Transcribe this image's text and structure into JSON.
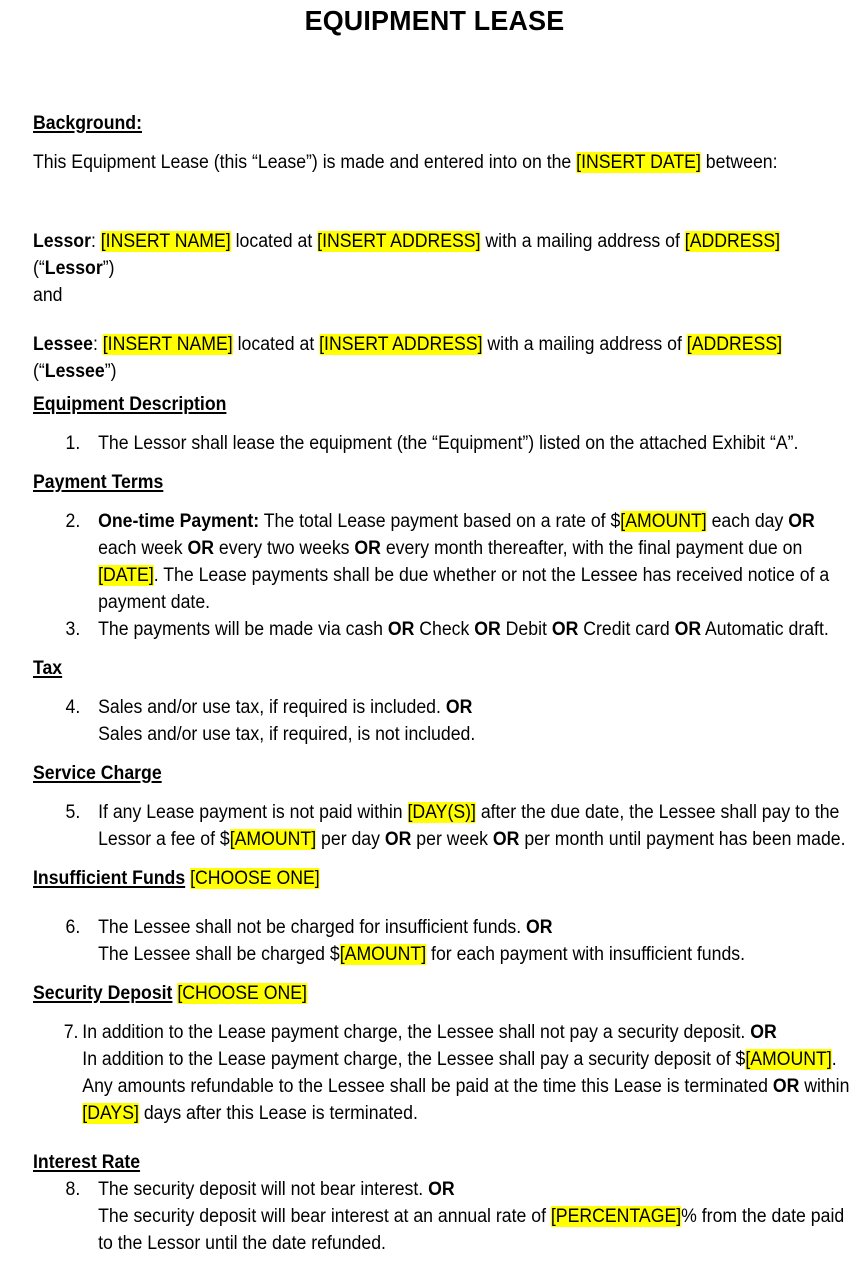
{
  "document": {
    "title": "EQUIPMENT LEASE",
    "sections": {
      "background": {
        "heading": "Background:",
        "intro_1": "This Equipment Lease (this “Lease”) is made and entered into on the ",
        "intro_date": "[INSERT DATE]",
        "intro_2": " between:"
      },
      "parties": {
        "lessor": {
          "label": "Lessor",
          "colon": ": ",
          "name": "[INSERT NAME]",
          "located_at": " located at ",
          "address": "[INSERT ADDRESS]",
          "mailing": " with a mailing address of ",
          "mailing_address": "[ADDRESS]",
          "quote_open": " (“",
          "term": "Lessor",
          "quote_close": "”)"
        },
        "conjunction": "and",
        "lessee": {
          "label": "Lessee",
          "colon": ": ",
          "name": "[INSERT NAME]",
          "located_at": " located at ",
          "address": "[INSERT ADDRESS]",
          "mailing": " with a mailing address of ",
          "mailing_address": "[ADDRESS]",
          "quote_open": " (“",
          "term": "Lessee",
          "quote_close": "”)"
        }
      },
      "equipment_description": {
        "heading": "Equipment Description",
        "item_number": "1.",
        "item_text": "The Lessor shall lease the equipment (the “Equipment”) listed on the attached Exhibit “A”."
      },
      "payment_terms": {
        "heading": "Payment Terms",
        "item2": {
          "number": "2.",
          "lead_bold": "One-time Payment:",
          "t1": " The total Lease payment based on a rate of $",
          "amount": "[AMOUNT]",
          "t2": " each day ",
          "or1": "OR",
          "t3": " each week ",
          "or2": "OR",
          "t4": " every two weeks ",
          "or3": "OR",
          "t5": " every month thereafter, with the final payment due on ",
          "date": "[DATE]",
          "t6": ". The Lease payments shall be due whether or not the Lessee has received notice of a payment date."
        },
        "item3": {
          "number": "3.",
          "t1": "The payments will be made via cash ",
          "or1": "OR",
          "t2": " Check ",
          "or2": "OR",
          "t3": " Debit ",
          "or3": "OR",
          "t4": " Credit card ",
          "or4": "OR",
          "t5": " Automatic draft."
        }
      },
      "tax": {
        "heading": "Tax",
        "item4": {
          "number": "4.",
          "option_a": "Sales and/or use tax, if required is included. ",
          "or": "OR",
          "option_b": "Sales and/or use tax, if required, is not included."
        }
      },
      "service_charge": {
        "heading": "Service Charge",
        "item5": {
          "number": "5.",
          "t1": "If any Lease payment is not paid within ",
          "days": "[DAY(S)]",
          "t2": " after the due date, the Lessee shall pay to the Lessor a fee of $",
          "amount": "[AMOUNT]",
          "t3": " per day ",
          "or1": "OR",
          "t4": " per week ",
          "or2": "OR",
          "t5": " per month until payment has been made."
        }
      },
      "insufficient_funds": {
        "heading": "Insufficient Funds",
        "heading_suffix": "[CHOOSE ONE]",
        "item6": {
          "number": "6.",
          "option_a": "The Lessee shall not be charged for insufficient funds. ",
          "or": "OR",
          "option_b_1": "The Lessee shall be charged $",
          "amount": "[AMOUNT]",
          "option_b_2": " for each payment with insufficient funds."
        }
      },
      "security_deposit": {
        "heading": "Security Deposit",
        "heading_suffix": "[CHOOSE ONE]",
        "item7": {
          "number": "7.",
          "option_a": "In addition to the Lease payment charge, the Lessee shall not pay a security deposit. ",
          "or_a": "OR",
          "option_b_1": "In addition to the Lease payment charge, the Lessee shall pay a security deposit of $",
          "amount": "[AMOUNT]",
          "option_b_2": ". Any amounts refundable to the Lessee shall be paid at the time this Lease is terminated ",
          "or_b": "OR",
          "option_b_3": " within ",
          "days": "[DAYS]",
          "option_b_4": " days after this Lease is terminated."
        }
      },
      "interest_rate": {
        "heading": "Interest Rate",
        "item8": {
          "number": "8.",
          "option_a": "The security deposit will not bear interest. ",
          "or": "OR",
          "option_b_1": "The security deposit will bear interest at an annual rate of ",
          "percentage": "[PERCENTAGE]",
          "option_b_2": "% from the date paid to the Lessor until the date refunded."
        }
      }
    }
  }
}
